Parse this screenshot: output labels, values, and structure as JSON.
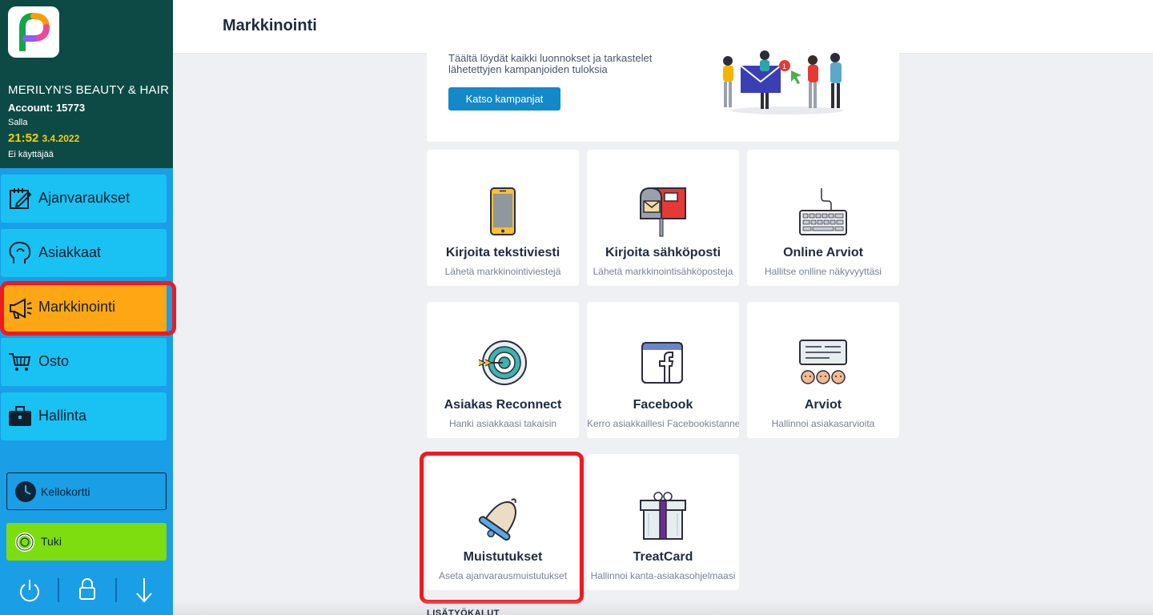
{
  "sidebar": {
    "salon_name": "MERILYN'S BEAUTY & HAIR",
    "account": "Account: 15773",
    "user": "Salla",
    "time": "21:52",
    "date": "3.4.2022",
    "no_user": "Ei käyttäjää",
    "items": [
      {
        "label": "Ajanvaraukset",
        "icon": "calendar-edit-icon"
      },
      {
        "label": "Asiakkaat",
        "icon": "customer-head-icon"
      },
      {
        "label": "Markkinointi",
        "icon": "megaphone-icon",
        "active": true
      },
      {
        "label": "Osto",
        "icon": "cart-icon"
      },
      {
        "label": "Hallinta",
        "icon": "briefcase-icon"
      }
    ],
    "clock_card": "Kellokortti",
    "support": "Tuki"
  },
  "header": {
    "title": "Markkinointi"
  },
  "banner": {
    "text": "Täältä löydät kaikki luonnokset ja tarkastelet lähetettyjen kampanjoiden tuloksia",
    "button": "Katso kampanjat"
  },
  "tiles": [
    {
      "title": "Kirjoita tekstiviesti",
      "subtitle": "Lähetä markkinointiviestejä",
      "icon": "phone-icon"
    },
    {
      "title": "Kirjoita sähköposti",
      "subtitle": "Lähetä markkinointisähköposteja",
      "icon": "mailbox-icon"
    },
    {
      "title": "Online Arviot",
      "subtitle": "Hallitse onlline näkyvyyttäsi",
      "icon": "keyboard-icon"
    },
    {
      "title": "Asiakas Reconnect",
      "subtitle": "Hanki asiakkaasi takaisin",
      "icon": "target-icon"
    },
    {
      "title": "Facebook",
      "subtitle": "Kerro asiakkaillesi Facebookistanne",
      "icon": "facebook-icon"
    },
    {
      "title": "Arviot",
      "subtitle": "Hallinnoi asiakasarvioita",
      "icon": "reviews-icon"
    },
    {
      "title": "Muistutukset",
      "subtitle": "Aseta ajanvarausmuistutukset",
      "icon": "bell-icon"
    },
    {
      "title": "TreatCard",
      "subtitle": "Hallinnoi kanta-asiakasohjelmaasi",
      "icon": "gift-icon"
    }
  ],
  "section_label": "LISÄTYÖKALUT",
  "colors": {
    "sidebar_top": "#0d4a46",
    "sidebar": "#1a9ee6",
    "nav_item": "#19c2f3",
    "nav_active": "#ffa615",
    "highlight": "#ee1921",
    "primary_button": "#1488c9",
    "support": "#7ddd0e"
  }
}
